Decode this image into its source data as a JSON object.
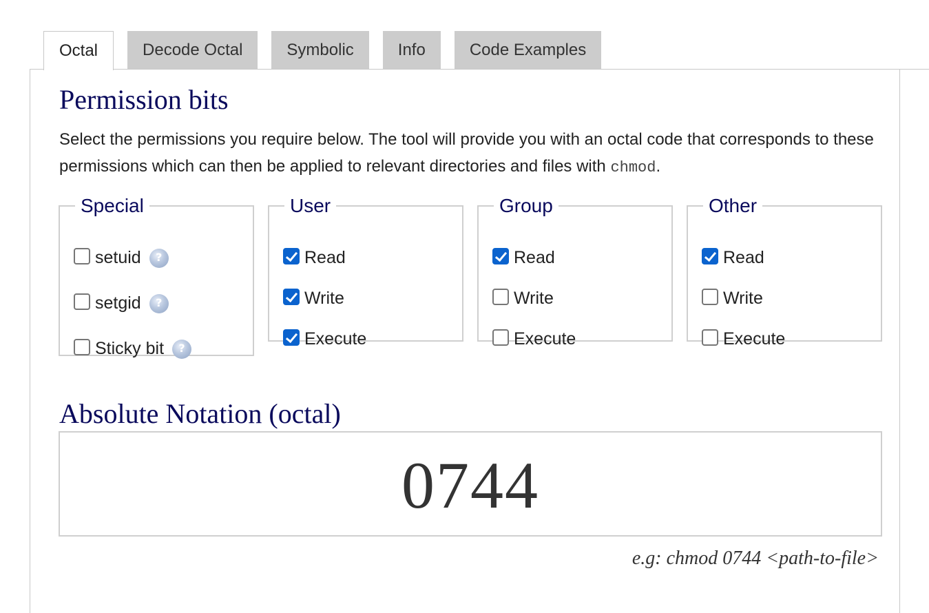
{
  "tabs": [
    {
      "label": "Octal",
      "active": true
    },
    {
      "label": "Decode Octal",
      "active": false
    },
    {
      "label": "Symbolic",
      "active": false
    },
    {
      "label": "Info",
      "active": false
    },
    {
      "label": "Code Examples",
      "active": false
    }
  ],
  "permission": {
    "title": "Permission bits",
    "description_before": "Select the permissions you require below. The tool will provide you with an octal code that corresponds to these permissions which can then be applied to relevant directories and files with ",
    "description_code": "chmod",
    "description_after": "."
  },
  "special": {
    "legend": "Special",
    "options": [
      {
        "label": "setuid",
        "checked": false,
        "icon": "help-icon"
      },
      {
        "label": "setgid",
        "checked": false,
        "icon": "help-icon"
      },
      {
        "label": "Sticky bit",
        "checked": false,
        "icon": "help-icon"
      }
    ]
  },
  "user": {
    "legend": "User",
    "options": [
      {
        "label": "Read",
        "checked": true
      },
      {
        "label": "Write",
        "checked": true
      },
      {
        "label": "Execute",
        "checked": true
      }
    ]
  },
  "group": {
    "legend": "Group",
    "options": [
      {
        "label": "Read",
        "checked": true
      },
      {
        "label": "Write",
        "checked": false
      },
      {
        "label": "Execute",
        "checked": false
      }
    ]
  },
  "other": {
    "legend": "Other",
    "options": [
      {
        "label": "Read",
        "checked": true
      },
      {
        "label": "Write",
        "checked": false
      },
      {
        "label": "Execute",
        "checked": false
      }
    ]
  },
  "absolute": {
    "title": "Absolute Notation (octal)",
    "value": "0744",
    "example": "e.g: chmod 0744 <path-to-file>"
  },
  "colors": {
    "heading": "#0a0a5c",
    "checkbox_checked": "#0b63ce",
    "tab_inactive": "#cccccc"
  }
}
